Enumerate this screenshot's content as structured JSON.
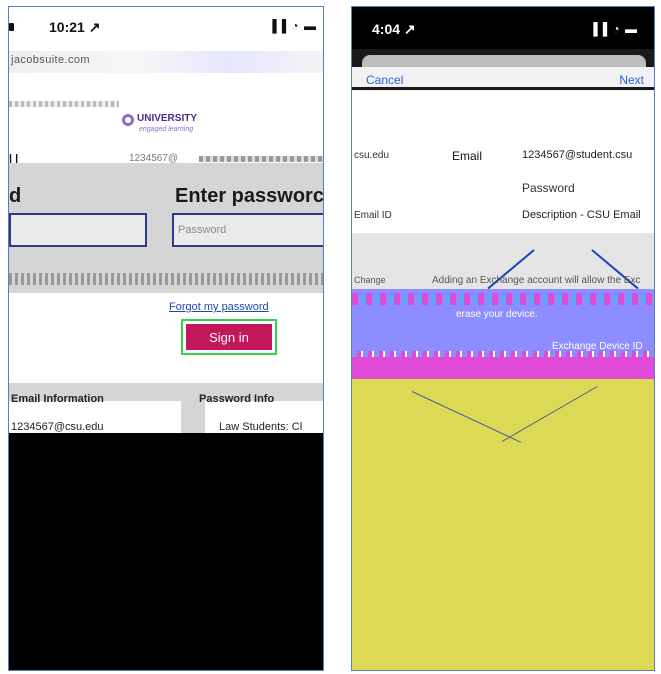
{
  "left_phone": {
    "status": {
      "time": "10:21 ↗",
      "signal": "▐▐ ◔ ▬"
    },
    "url_bar": "jacobsuite.com",
    "logo": {
      "brand": "UNIVERSITY",
      "tagline": "engaged learning"
    },
    "identity_line": "1234567@",
    "modal": {
      "left_heading": "d",
      "right_heading": "Enter passworc",
      "password_placeholder": "Password"
    },
    "forgot_link": "Forgot my password",
    "sign_in_label": "Sign in",
    "lower": {
      "card1_title": "Email Information",
      "card2_title": "Password Info",
      "card1_text": "1234567@csu.edu",
      "card2_text": "Law Students: Cl"
    }
  },
  "right_phone": {
    "status": {
      "time": "4:04 ↗",
      "signal": "▐▐ ◔ ▬"
    },
    "nav": {
      "cancel": "Cancel",
      "next": "Next"
    },
    "form": {
      "email_label": "Email",
      "email_value": "1234567@student.csu",
      "side_email": "csu.edu",
      "password_label": "Password",
      "description_label": "Description",
      "description_value": "Description - CSU Email",
      "side_desc": "Email ID"
    },
    "info": {
      "exchange_note": "Adding an Exchange account will allow the Exc",
      "side_change": "Change",
      "manage_text": "erase your device.",
      "configure_label": "Exchange Device ID"
    }
  }
}
